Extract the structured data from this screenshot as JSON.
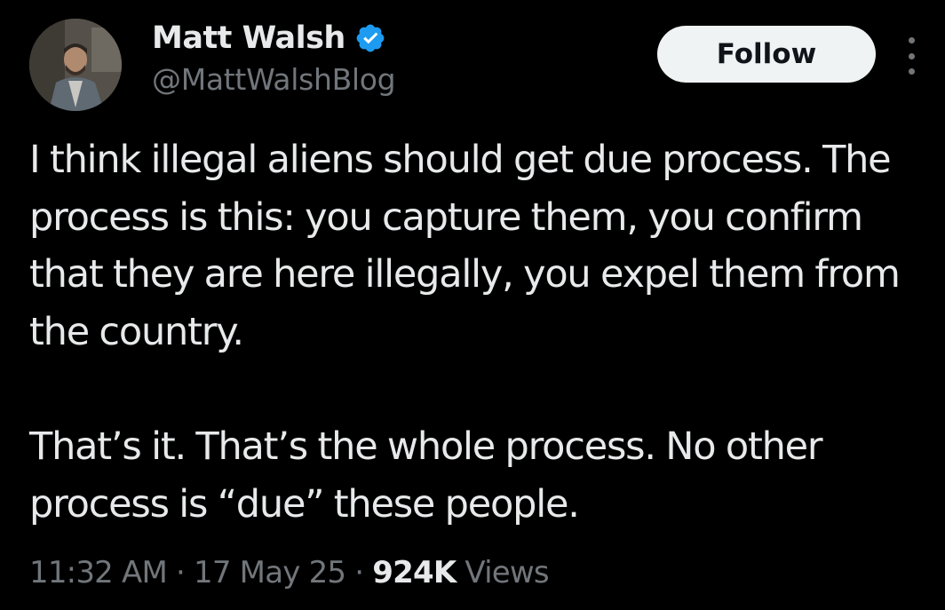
{
  "author": {
    "display_name": "Matt Walsh",
    "handle": "@MattWalshBlog",
    "verified_icon": "verified-badge-icon",
    "verified_color": "#1d9bf0"
  },
  "actions": {
    "follow_label": "Follow",
    "more_icon": "more-options-icon"
  },
  "tweet": {
    "paragraphs": [
      "I think illegal aliens should get due process. The process is this: you capture them, you confirm that they are here illegally, you expel them from the country.",
      "That’s it. That’s the whole process. No other process is “due” these people."
    ]
  },
  "meta": {
    "time": "11:32 AM",
    "date": "17 May 25",
    "separator": "·",
    "views_count": "924K",
    "views_label": "Views"
  },
  "colors": {
    "background": "#000000",
    "primary_text": "#e7e9ea",
    "secondary_text": "#71767b",
    "button_bg": "#eff3f4",
    "button_text": "#0f1419"
  }
}
